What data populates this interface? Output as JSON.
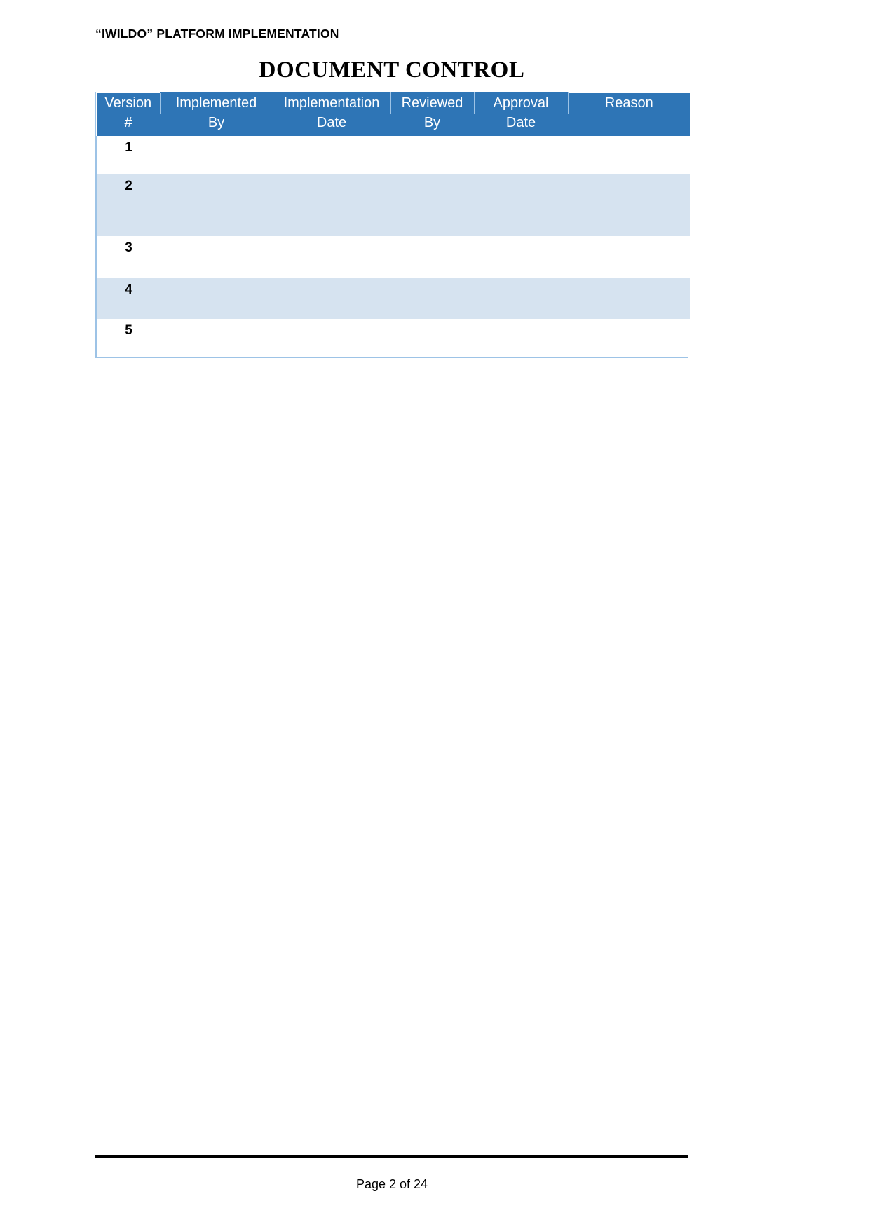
{
  "page": {
    "running_header": "“IWILDO” PLATFORM IMPLEMENTATION",
    "title": "DOCUMENT CONTROL"
  },
  "table": {
    "columns": [
      {
        "line1": "Version",
        "line2": "#",
        "boxed": false
      },
      {
        "line1": "Implemented",
        "line2": "By",
        "boxed": true
      },
      {
        "line1": "Implementation",
        "line2": "Date",
        "boxed": true
      },
      {
        "line1": "Reviewed",
        "line2": "By",
        "boxed": true
      },
      {
        "line1": "Approval",
        "line2": "Date",
        "boxed": true
      },
      {
        "line1": "Reason",
        "line2": "",
        "boxed": false
      }
    ],
    "rows": [
      {
        "version": "1",
        "implemented_by": "",
        "implementation_date": "",
        "reviewed_by": "",
        "approval_date": "",
        "reason": ""
      },
      {
        "version": "2",
        "implemented_by": "",
        "implementation_date": "",
        "reviewed_by": "",
        "approval_date": "",
        "reason": ""
      },
      {
        "version": "3",
        "implemented_by": "",
        "implementation_date": "",
        "reviewed_by": "",
        "approval_date": "",
        "reason": ""
      },
      {
        "version": "4",
        "implemented_by": "",
        "implementation_date": "",
        "reviewed_by": "",
        "approval_date": "",
        "reason": ""
      },
      {
        "version": "5",
        "implemented_by": "",
        "implementation_date": "",
        "reviewed_by": "",
        "approval_date": "",
        "reason": ""
      }
    ]
  },
  "footer": {
    "page_label": "Page 2 of 24"
  },
  "colors": {
    "header_blue": "#2e75b6",
    "row_alt_blue": "#d6e3f0",
    "table_border": "#9dc3e6",
    "footer_rule": "#000000"
  }
}
